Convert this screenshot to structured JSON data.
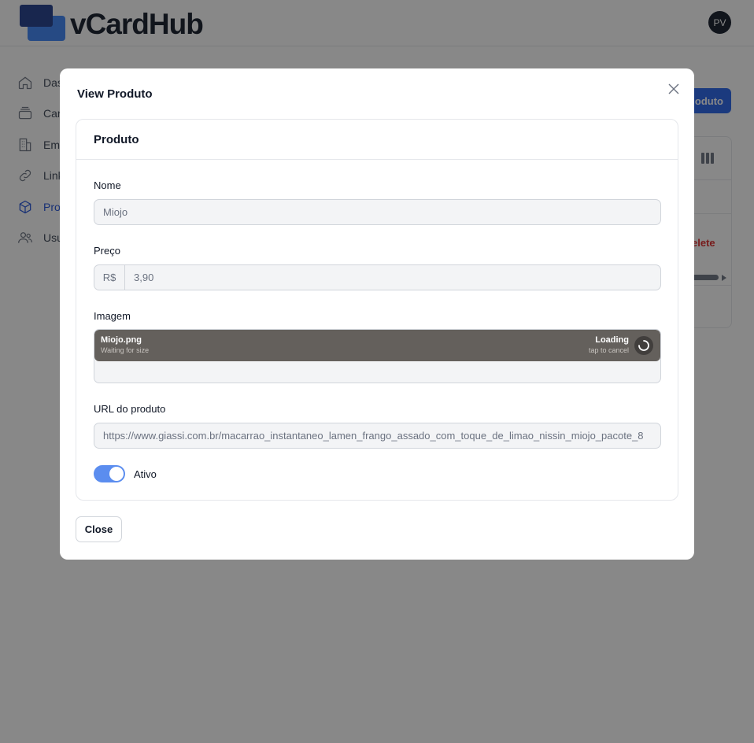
{
  "app": {
    "brand": "vCardHub",
    "avatar_initials": "PV",
    "accent_color": "#2563eb"
  },
  "sidebar": {
    "items": [
      {
        "label": "Das",
        "icon": "home-icon",
        "active": false
      },
      {
        "label": "Car",
        "icon": "cards-icon",
        "active": false
      },
      {
        "label": "Emp",
        "icon": "building-icon",
        "active": false
      },
      {
        "label": "Link",
        "icon": "link-icon",
        "active": false
      },
      {
        "label": "Proc",
        "icon": "cube-icon",
        "active": true
      },
      {
        "label": "Usu",
        "icon": "users-icon",
        "active": false
      }
    ]
  },
  "page": {
    "new_button_label": "oduto",
    "row_action_delete": "elete"
  },
  "modal": {
    "title": "View Produto",
    "section_title": "Produto",
    "fields": {
      "nome": {
        "label": "Nome",
        "value": "Miojo"
      },
      "preco": {
        "label": "Preço",
        "prefix": "R$",
        "value": "3,90"
      },
      "imagem": {
        "label": "Imagem",
        "file_name": "Miojo.png",
        "file_status": "Waiting for size",
        "load_status": "Loading",
        "load_hint": "tap to cancel"
      },
      "url": {
        "label": "URL do produto",
        "value": "https://www.giassi.com.br/macarrao_instantaneo_lamen_frango_assado_com_toque_de_limao_nissin_miojo_pacote_8"
      },
      "ativo": {
        "label": "Ativo",
        "checked": true
      }
    },
    "close_button_label": "Close"
  }
}
